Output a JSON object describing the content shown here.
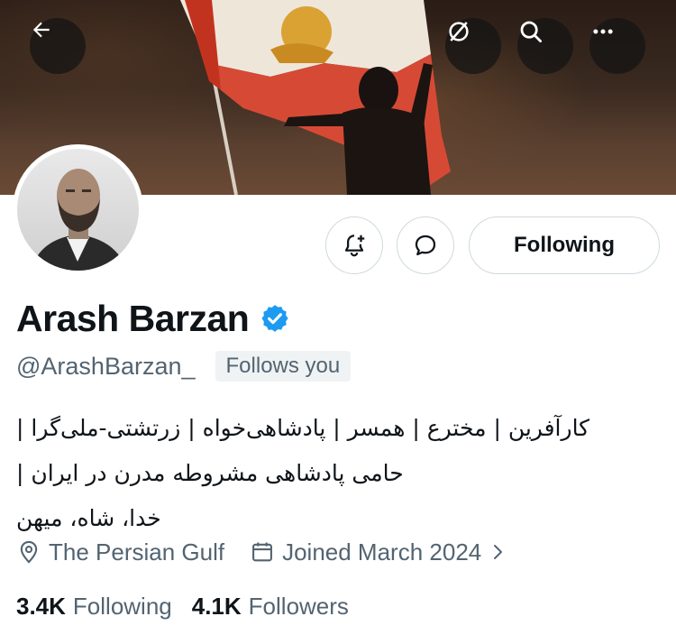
{
  "profile": {
    "name": "Arash Barzan",
    "handle": "@ArashBarzan_",
    "follows_you": "Follows you",
    "verified": true,
    "bio_lines": [
      "کارآفرین | مخترع | همسر | پادشاهی‌خواه | زرتشتی-ملی‌گرا |",
      "حامی پادشاهی مشروطه مدرن در ایران |",
      "خدا، شاه، میهن"
    ],
    "location": "The Persian Gulf",
    "joined": "Joined March 2024",
    "following_count": "3.4K",
    "following_label": "Following",
    "followers_count": "4.1K",
    "followers_label": "Followers"
  },
  "actions": {
    "following_button": "Following"
  },
  "icons": {
    "back": "arrow-left-icon",
    "grok": "grok-icon",
    "search": "search-icon",
    "more": "more-icon",
    "notify": "bell-plus-icon",
    "message": "message-icon",
    "location": "location-pin-icon",
    "calendar": "calendar-icon",
    "verified": "verified-badge-icon"
  },
  "colors": {
    "verified_blue": "#1d9bf0",
    "text_primary": "#0f1419",
    "text_secondary": "#536471",
    "border": "#cfd9de"
  }
}
